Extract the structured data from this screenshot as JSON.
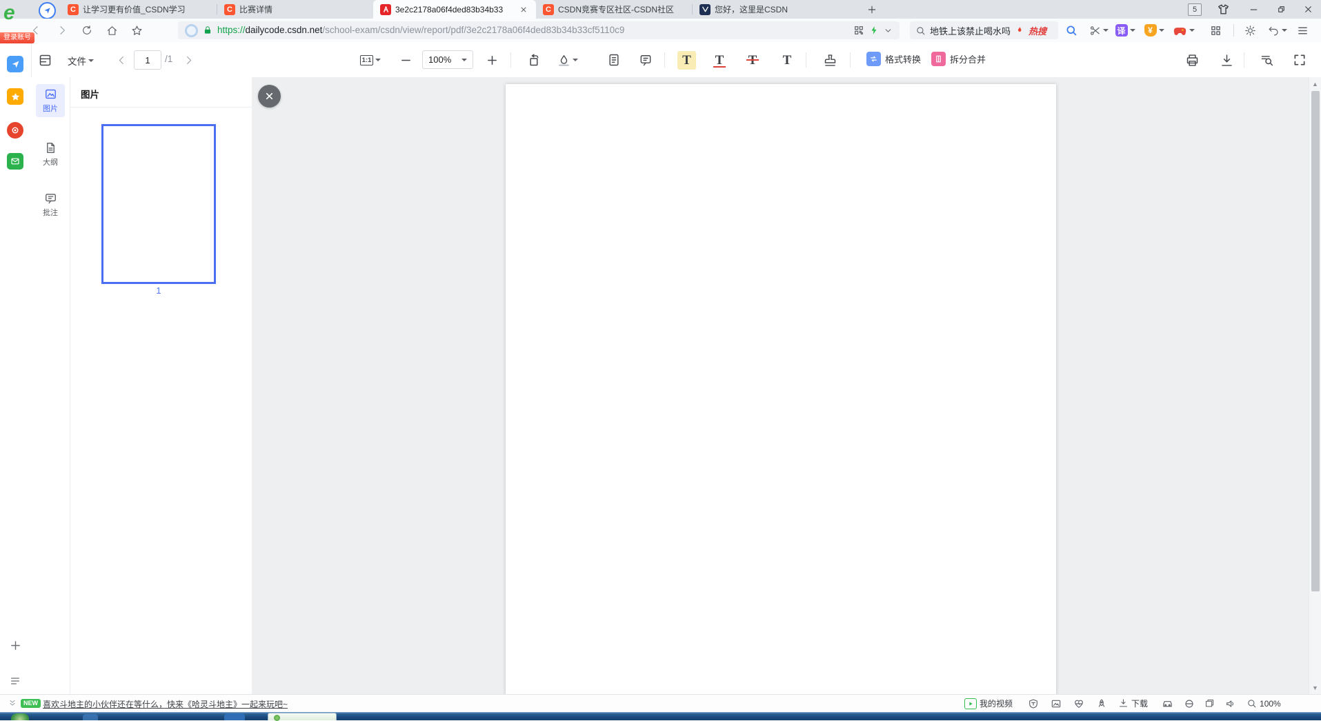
{
  "browser": {
    "login_badge": "登录账号",
    "tab_count": "5",
    "tabs": [
      {
        "label": "让学习更有价值_CSDN学习"
      },
      {
        "label": "比赛详情"
      },
      {
        "label": "3e2c2178a06f4ded83b34b33",
        "active": true
      },
      {
        "label": "CSDN竞赛专区社区-CSDN社区"
      },
      {
        "label": "您好，这里是CSDN"
      }
    ],
    "address": {
      "scheme": "https://",
      "host": "dailycode.csdn.net",
      "path": "/school-exam/csdn/view/report/pdf/3e2c2178a06f4ded83b34b33cf5110c9"
    },
    "search": {
      "query": "地铁上该禁止喝水吗",
      "hot_label": "热搜"
    },
    "icons": {
      "csdn_glyph": "C",
      "translate_glyph": "译",
      "wallet_glyph": "¥"
    }
  },
  "pdf_toolbar": {
    "file_label": "文件",
    "page_current": "1",
    "page_total": "/1",
    "fit_label": "1:1",
    "zoom_level": "100%",
    "minus_glyph": "−",
    "plus_glyph": "+",
    "text_tool_glyph": "T",
    "convert_label": "格式转换",
    "split_label": "拆分合并"
  },
  "sidebar": {
    "items": [
      {
        "label": "图片",
        "selected": true
      },
      {
        "label": "大纲"
      },
      {
        "label": "批注"
      }
    ]
  },
  "thumb_panel": {
    "title": "图片",
    "page_label": "1"
  },
  "statusbar": {
    "new_badge": "NEW",
    "promo": "喜欢斗地主的小伙伴还在等什么，快来《哈灵斗地主》一起来玩吧~",
    "my_videos": "我的视频",
    "download_label": "下载",
    "zoom": "100%"
  },
  "colors": {
    "accent_blue": "#4a6cf7",
    "thumb_border": "#4a6ff3",
    "csdn_red": "#fc5531",
    "hot_red": "#e23d3d",
    "highlight_yellow": "#f9ecb5",
    "new_green": "#3fbf53",
    "canvas_gray": "#edeff1"
  }
}
